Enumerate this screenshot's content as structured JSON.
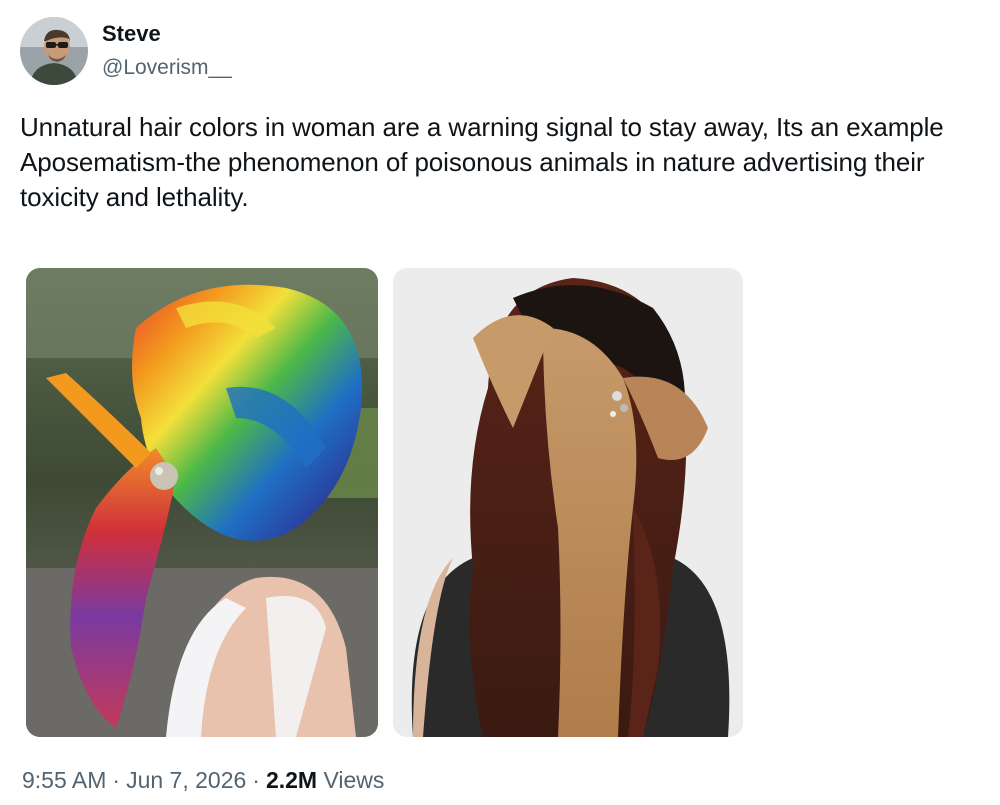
{
  "author": {
    "display_name": "Steve",
    "handle": "@Loverism__"
  },
  "post": {
    "text": "Unnatural hair colors in woman are a warning signal to stay away, Its an example Aposematism-the phenomenon of poisonous animals in nature advertising their toxicity and lethality.",
    "media": [
      {
        "kind": "photo"
      },
      {
        "kind": "photo"
      }
    ]
  },
  "meta": {
    "time": "9:55 AM",
    "separator": "·",
    "date": "Jun 7, 2026",
    "views_count": "2.2M",
    "views_label": "Views"
  }
}
